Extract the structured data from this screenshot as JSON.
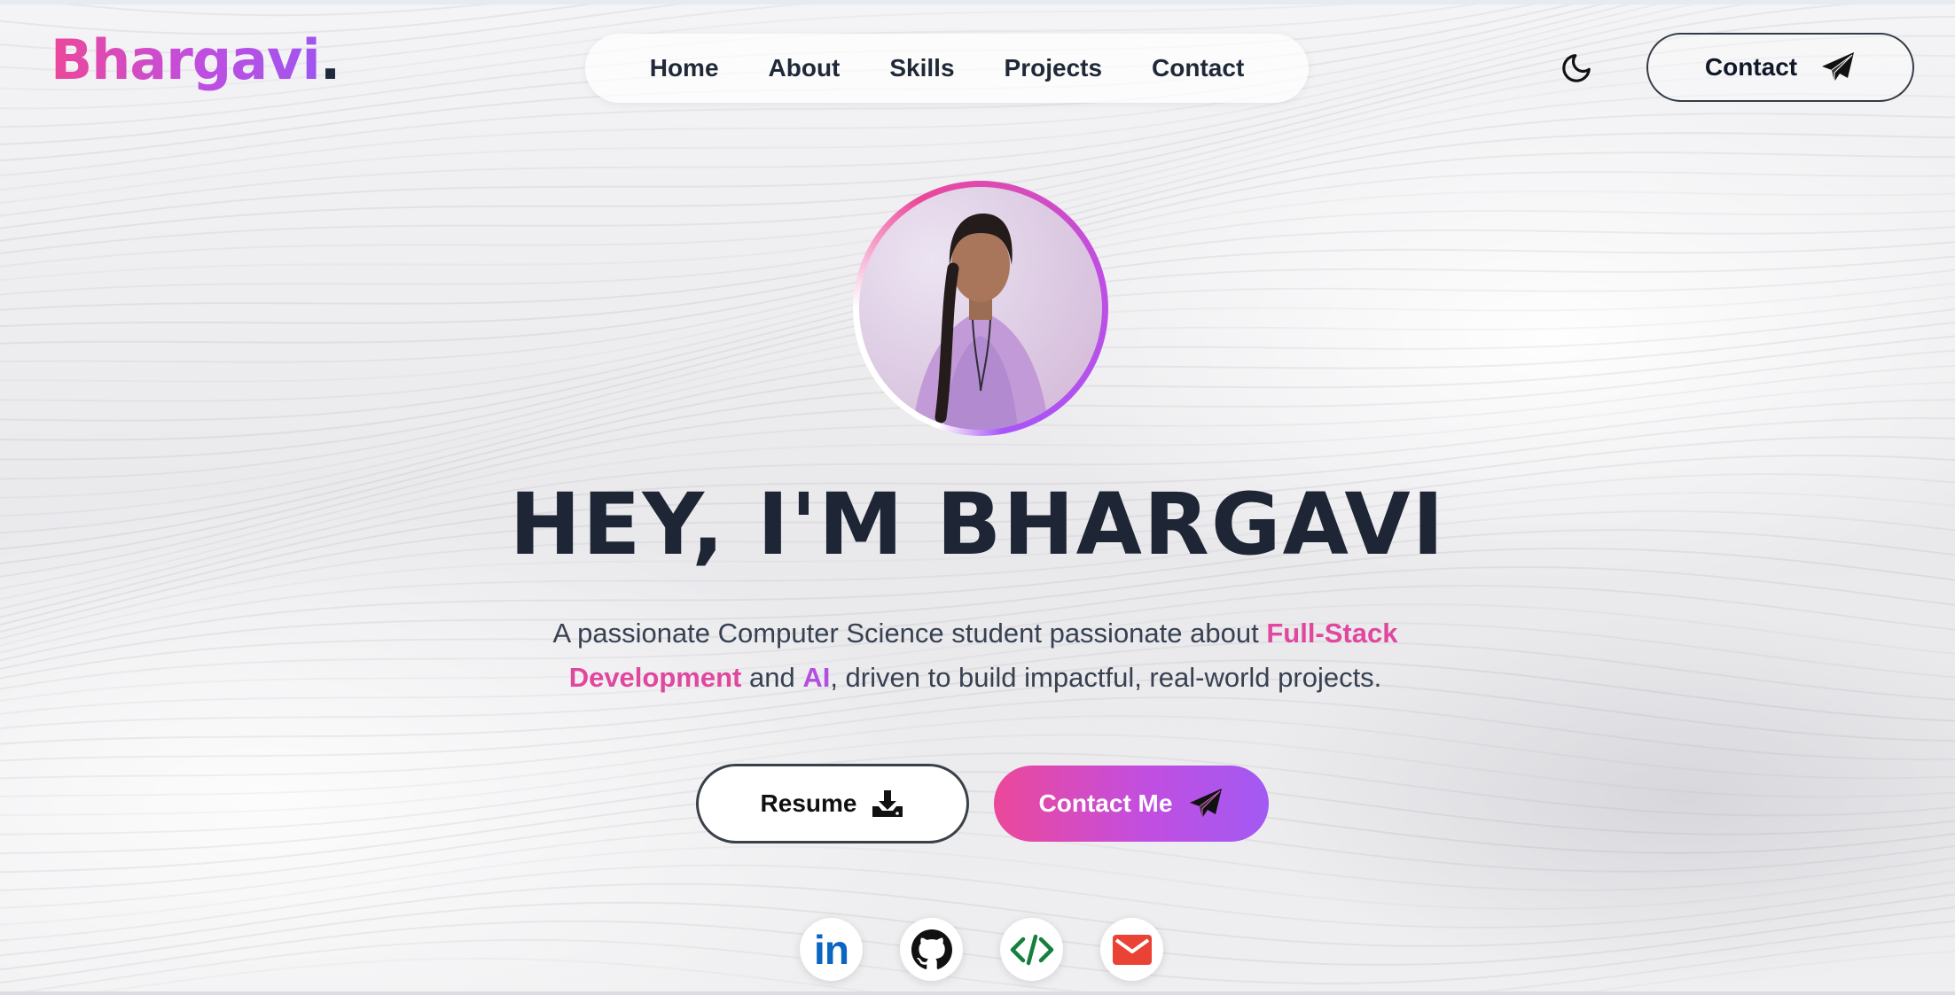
{
  "brand": {
    "name": "Bhargavi",
    "dot": "."
  },
  "nav": {
    "items": [
      "Home",
      "About",
      "Skills",
      "Projects",
      "Contact"
    ]
  },
  "header": {
    "theme_icon": "moon-icon",
    "contact_label": "Contact",
    "contact_icon": "paper-plane-icon"
  },
  "hero": {
    "title": "HEY, I'M BHARGAVI",
    "subtitle_prefix": "A passionate Computer Science student passionate about ",
    "subtitle_highlight1": "Full-Stack Development",
    "subtitle_mid": " and ",
    "subtitle_highlight2": "AI",
    "subtitle_suffix": ", driven to build impactful, real-world projects."
  },
  "buttons": {
    "resume_label": "Resume",
    "resume_icon": "download-icon",
    "contact_me_label": "Contact Me",
    "contact_me_icon": "paper-plane-icon"
  },
  "socials": [
    {
      "name": "LinkedIn",
      "icon": "linkedin-icon",
      "text": "in"
    },
    {
      "name": "GitHub",
      "icon": "github-icon"
    },
    {
      "name": "Code",
      "icon": "code-icon",
      "text": "</>"
    },
    {
      "name": "Gmail",
      "icon": "gmail-icon"
    }
  ],
  "colors": {
    "accent_pink": "#ec4899",
    "accent_purple": "#a855f7",
    "title": "#1e2635",
    "linkedin": "#0a66c2",
    "code": "#15803d",
    "gmail": "#ea4335"
  }
}
